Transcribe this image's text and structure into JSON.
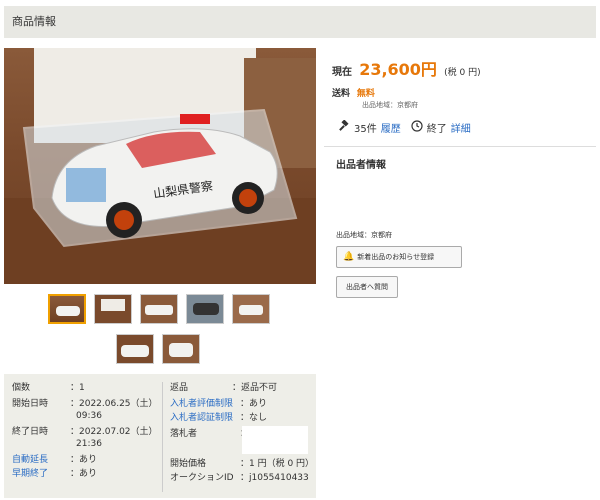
{
  "header": {
    "title": "商品情報"
  },
  "price": {
    "label": "現在",
    "value": "23,600円",
    "tax": "(税 0 円)"
  },
  "shipping": {
    "label": "送料",
    "value": "無料",
    "region": "出品地域：京都府"
  },
  "bids": {
    "count": "35件",
    "history": "履歴",
    "status": "終了",
    "detail": "詳細"
  },
  "seller": {
    "title": "出品者情報",
    "region": "出品地域：京都府",
    "notify_button": "新着出品のお知らせ登録",
    "question_button": "出品者へ質問"
  },
  "photo": {
    "car_text": "山梨県警察"
  },
  "details_left": [
    {
      "label": "個数",
      "value": "：1",
      "link": false
    },
    {
      "label": "開始日時",
      "value": "：2022.06.25（土）",
      "value2": "09:36",
      "link": false
    },
    {
      "label": "終了日時",
      "value": "：2022.07.02（土）",
      "value2": "21:36",
      "link": false
    },
    {
      "label": "自動延長",
      "value": "：あり",
      "link": true
    },
    {
      "label": "早期終了",
      "value": "：あり",
      "link": true
    }
  ],
  "details_right": [
    {
      "label": "返品",
      "value": "：返品不可",
      "link": false
    },
    {
      "label": "入札者評価制限",
      "value": "：あり",
      "link": true
    },
    {
      "label": "入札者認証制限",
      "value": "：なし",
      "link": true
    },
    {
      "label": "落札者",
      "value": "：",
      "link": false
    },
    {
      "label": "開始価格",
      "value": "：1 円（税 0 円）",
      "link": false
    },
    {
      "label": "オークションID",
      "value": "：j1055410433",
      "link": false
    }
  ],
  "colors": {
    "accent": "#e7780a",
    "link": "#2a6cc4",
    "panel": "#eeeee8"
  }
}
